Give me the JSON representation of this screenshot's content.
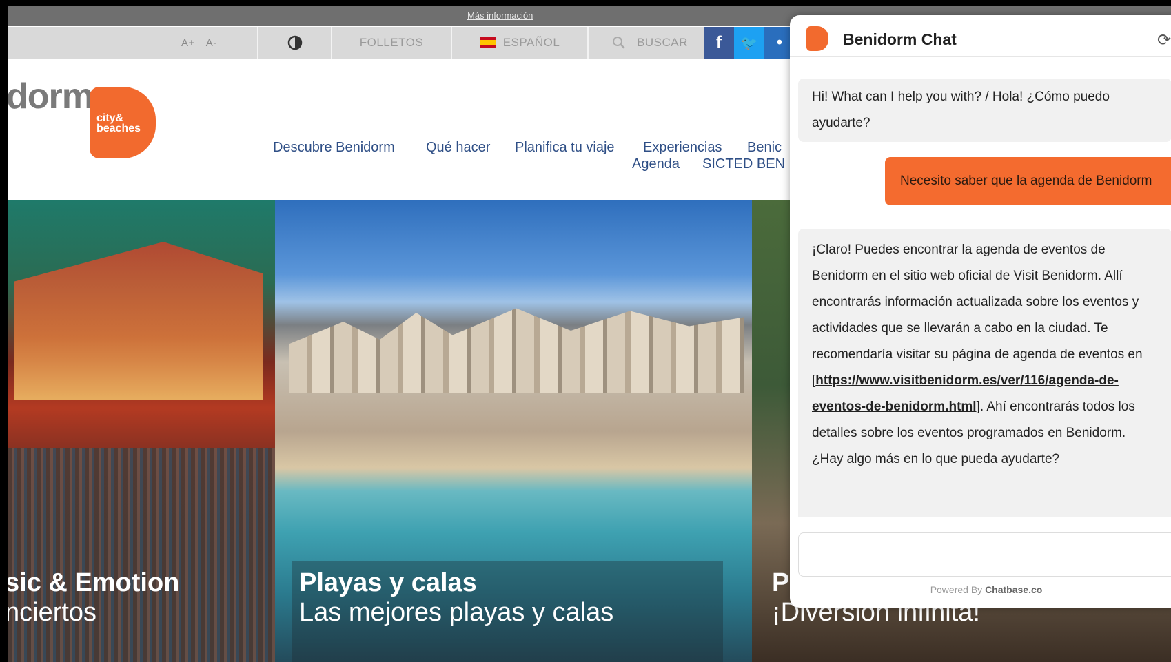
{
  "notice": {
    "link_text": "Más información"
  },
  "toolbar": {
    "font_bigger": "A+",
    "font_smaller": "A-",
    "folletos": "FOLLETOS",
    "language": "ESPAÑOL",
    "search": "BUSCAR"
  },
  "header": {
    "logo_text": "dorm",
    "logo_badge": "city& beaches",
    "nav": [
      "Descubre Benidorm",
      "Qué hacer",
      "Planifica tu viaje",
      "Experiencias",
      "Benic",
      "Agenda",
      "SICTED BEN"
    ]
  },
  "hero": {
    "panel1": {
      "title": "sic & Emotion",
      "subtitle": "nciertos"
    },
    "panel2": {
      "title": "Playas y calas",
      "subtitle": "Las mejores playas y calas"
    },
    "panel3": {
      "title": "P",
      "subtitle": "¡Diversión infinita!"
    }
  },
  "chat": {
    "title": "Benidorm Chat",
    "greeting": "Hi! What can I help you with? / Hola! ¿Cómo puedo ayudarte?",
    "user_message": "Necesito saber que la agenda de Benidorm",
    "bot_reply_pre": "¡Claro! Puedes encontrar la agenda de eventos de Benidorm en el sitio web oficial de Visit Benidorm. Allí encontrarás información actualizada sobre los eventos y actividades que se llevarán a cabo en la ciudad. Te recomendaría visitar su página de agenda de eventos en [",
    "bot_reply_link": "https://www.visitbenidorm.es/ver/116/agenda-de-eventos-de-benidorm.html",
    "bot_reply_post": "]. Ahí encontrarás todos los detalles sobre los eventos programados en Benidorm. ¿Hay algo más en lo que pueda ayudarte?",
    "powered_prefix": "Powered By",
    "powered_brand": "Chatbase.co"
  },
  "colors": {
    "brand_orange": "#f26a2e",
    "nav_blue": "#2f4f86",
    "facebook": "#3b5998",
    "twitter": "#1da1f2"
  }
}
